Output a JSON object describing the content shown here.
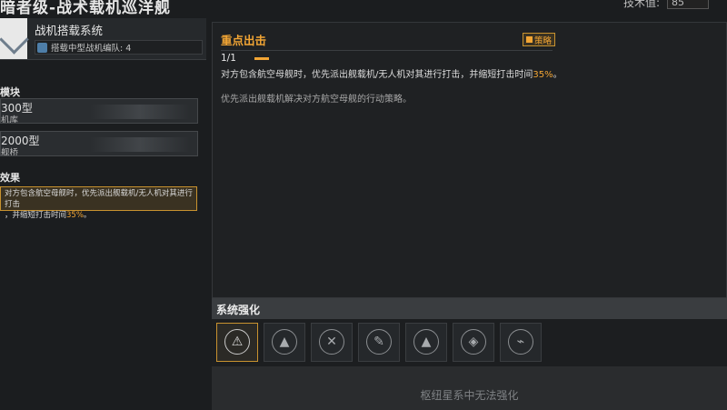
{
  "top": {
    "title": "暗者级-战术载机巡洋舰",
    "tech_label": "技术值:",
    "tech_value": "85"
  },
  "left": {
    "system_title": "战机搭载系统",
    "system_sub": "搭载中型战机编队: 4",
    "modules_label": "模块",
    "modules": [
      {
        "name": "300型",
        "type": "机库"
      },
      {
        "name": "2000型",
        "type": "舰桥"
      }
    ],
    "effect_label": "效果",
    "effect_line1": "对方包含航空母舰时，优先派出舰载机/无人机对其进行打击",
    "effect_line2_prefix": "，并缩短打击时间",
    "effect_line2_value": "35%",
    "effect_line2_suffix": "。"
  },
  "detail": {
    "title": "重点出击",
    "tag": "策略",
    "count": "1/1",
    "desc_prefix": "对方包含航空母舰时，优先派出舰载机/无人机对其进行打击，并缩短打击时间",
    "desc_value": "35%",
    "desc_suffix": "。",
    "strategy": "优先派出舰载机解决对方航空母舰的行动策略。"
  },
  "enhancement": {
    "title": "系统强化",
    "slots": [
      {
        "icon": "ship-alert-icon",
        "glyph": "⚠",
        "active": true
      },
      {
        "icon": "ship-up-icon",
        "glyph": "▲"
      },
      {
        "icon": "ship-cross-icon",
        "glyph": "✕"
      },
      {
        "icon": "ship-wrench-icon",
        "glyph": "✎"
      },
      {
        "icon": "ship-up-icon",
        "glyph": "▲"
      },
      {
        "icon": "ship-target-icon",
        "glyph": "◈"
      },
      {
        "icon": "ship-signal-icon",
        "glyph": "⌁"
      }
    ],
    "message": "枢纽星系中无法强化"
  },
  "colors": {
    "accent": "#f2a534",
    "panel": "#1f2123",
    "border": "#34373a"
  }
}
